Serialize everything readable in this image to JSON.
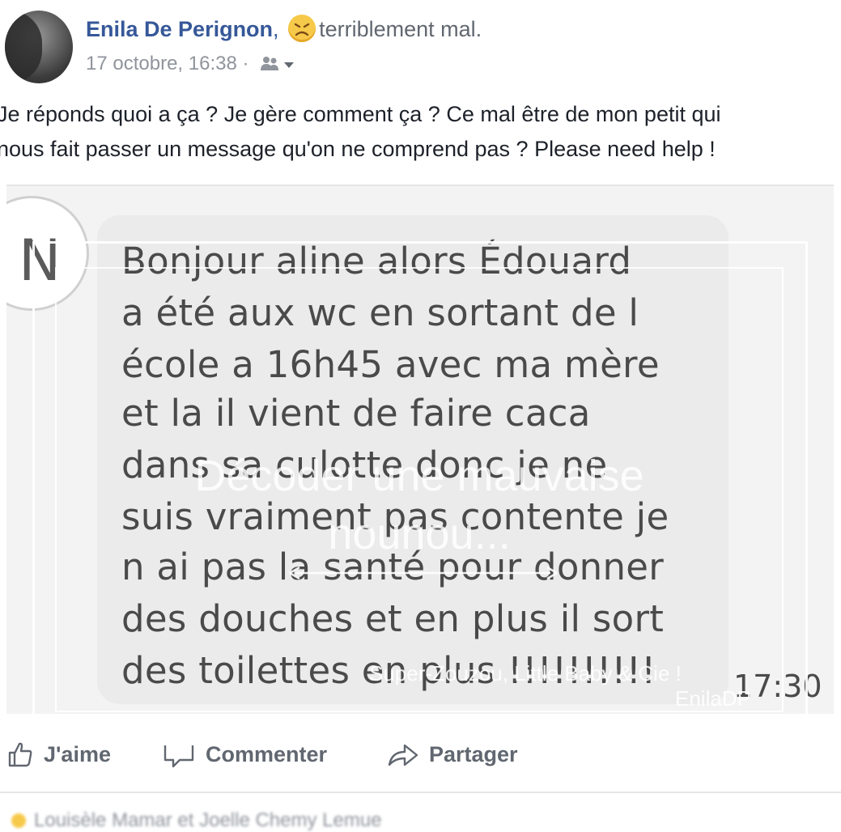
{
  "post": {
    "author": "Enila De Perignon",
    "separator": ",",
    "feeling": "terriblement mal.",
    "feeling_icon": "sad-face-icon",
    "timestamp": "17 octobre, 16:38",
    "meta_separator": "·",
    "audience_icon": "friends-icon",
    "text_lines": [
      "Je réponds quoi a ça ? Je gère comment ça ? Ce mal être de mon petit qui",
      "nous fait passer un message qu'on ne comprend pas ? Please need help !"
    ]
  },
  "screenshot": {
    "contact_initial": "N",
    "message_lines": [
      "Bonjour aline alors Édouard",
      "a été aux wc en sortant de l",
      "école a 16h45 avec ma mère",
      "et la il vient de faire caca",
      "dans sa culotte donc je ne",
      "suis vraiment pas contente je",
      "n ai pas la santé pour donner",
      "des douches et en plus il sort",
      "des toilettes en plus !!!!!!!!!!"
    ],
    "message_time": "17:30",
    "watermark": {
      "title_lines": [
        "Décoder une mauvaise",
        "nounou..."
      ],
      "credit_line1": "Super-Zouzou, Little Baby & Cie !",
      "credit_line2": "EnilaDP"
    }
  },
  "actions": {
    "like": "J'aime",
    "comment": "Commenter",
    "share": "Partager"
  },
  "reactions_summary": "Louisèle Mamar et Joelle Chemy Lemue",
  "colors": {
    "link_blue": "#365899",
    "meta_gray": "#90949c",
    "action_gray": "#616770",
    "text": "#1d2129"
  }
}
